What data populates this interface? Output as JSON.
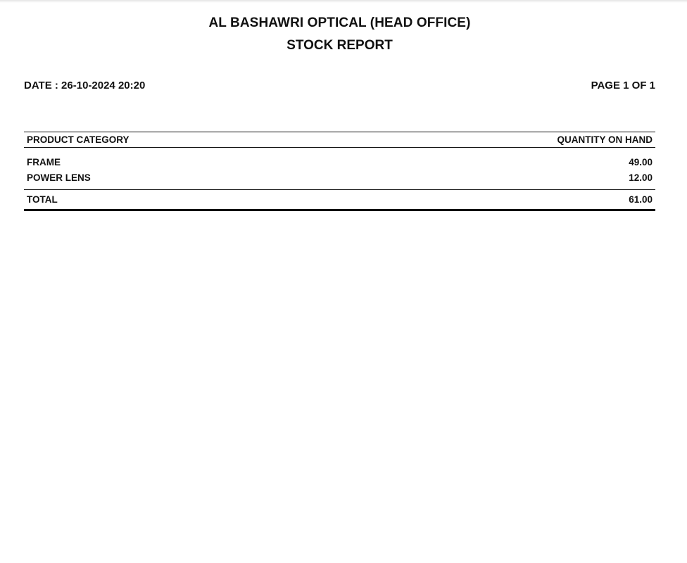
{
  "report": {
    "company_name": "AL BASHAWRI OPTICAL (HEAD OFFICE)",
    "title": "STOCK REPORT",
    "date_label": "DATE : 26-10-2024 20:20",
    "page_label": "PAGE 1 OF 1"
  },
  "table": {
    "columns": [
      "PRODUCT CATEGORY",
      "QUANTITY ON HAND"
    ],
    "rows": [
      {
        "category": "FRAME",
        "quantity": "49.00"
      },
      {
        "category": "POWER LENS",
        "quantity": "12.00"
      }
    ],
    "total": {
      "label": "TOTAL",
      "quantity": "61.00"
    }
  }
}
